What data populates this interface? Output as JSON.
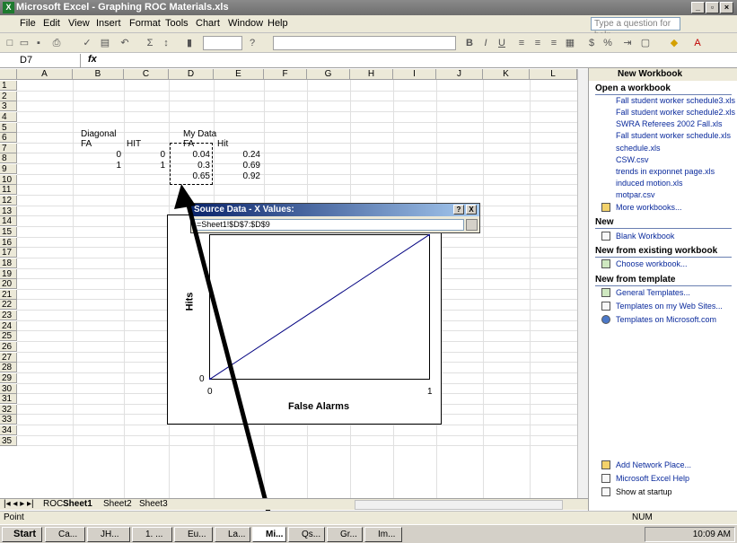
{
  "window": {
    "title": "Microsoft Excel - Graphing ROC Materials.xls"
  },
  "menu": {
    "items": [
      "File",
      "Edit",
      "View",
      "Insert",
      "Format",
      "Tools",
      "Chart",
      "Window",
      "Help"
    ],
    "help_placeholder": "Type a question for help"
  },
  "formula_bar": {
    "name_box": "D7",
    "fx": "fx"
  },
  "columns": [
    "A",
    "B",
    "C",
    "D",
    "E",
    "F",
    "G",
    "H",
    "I",
    "J",
    "K",
    "L"
  ],
  "rows": [
    "1",
    "2",
    "3",
    "4",
    "5",
    "6",
    "7",
    "8",
    "9",
    "10",
    "11",
    "12",
    "13",
    "14",
    "15",
    "16",
    "17",
    "18",
    "19",
    "20",
    "21",
    "22",
    "23",
    "24",
    "25",
    "26",
    "27",
    "28",
    "29",
    "30",
    "31",
    "32",
    "33",
    "34",
    "35"
  ],
  "cells": {
    "b5": "Diagonal",
    "d5": "My Data",
    "b6": "FA",
    "c6": "HIT",
    "d6": "FA",
    "e6": "Hit",
    "b7": "0",
    "c7": "0",
    "d7": "0.04",
    "e7": "0.24",
    "b8": "1",
    "c8": "1",
    "d8": "0.3",
    "e8": "0.69",
    "d9": "0.65",
    "e9": "0.92"
  },
  "dialog": {
    "title": "Source Data - X Values:",
    "help": "?",
    "close": "X",
    "range": "=Sheet1!$D$7:$D$9"
  },
  "chart_data": {
    "type": "line",
    "xlabel": "False Alarms",
    "ylabel": "Hits",
    "x_ticks": [
      "0",
      "1"
    ],
    "y_ticks": [
      "0"
    ],
    "xlim": [
      0,
      1
    ],
    "ylim": [
      0,
      1
    ],
    "series": [
      {
        "x": [
          0,
          1
        ],
        "y": [
          0,
          1
        ]
      }
    ]
  },
  "sheet_tabs": {
    "tabs": [
      "ROC",
      "Sheet1",
      "Sheet2",
      "Sheet3"
    ],
    "active": "Sheet1"
  },
  "status": {
    "mode": "Point",
    "num": "NUM"
  },
  "taskpane": {
    "title": "New Workbook",
    "open_header": "Open a workbook",
    "recent": [
      "Fall student worker schedule3.xls",
      "Fall student worker schedule2.xls",
      "SWRA Referees 2002 Fall.xls",
      "Fall student worker schedule.xls",
      "schedule.xls",
      "CSW.csv",
      "trends in exponnet page.xls",
      "induced motion.xls",
      "motpar.csv"
    ],
    "more": "More workbooks...",
    "new_header": "New",
    "blank": "Blank Workbook",
    "existing_header": "New from existing workbook",
    "choose": "Choose workbook...",
    "template_header": "New from template",
    "general": "General Templates...",
    "web": "Templates on my Web Sites...",
    "ms": "Templates on Microsoft.com",
    "add_place": "Add Network Place...",
    "excel_help": "Microsoft Excel Help",
    "startup": "Show at startup"
  },
  "taskbar": {
    "start": "Start",
    "tasks": [
      "Ca...",
      "JH...",
      "1. ...",
      "Eu...",
      "La...",
      "Mi...",
      "Qs...",
      "Gr...",
      "Im..."
    ],
    "clock": "10:09 AM"
  }
}
